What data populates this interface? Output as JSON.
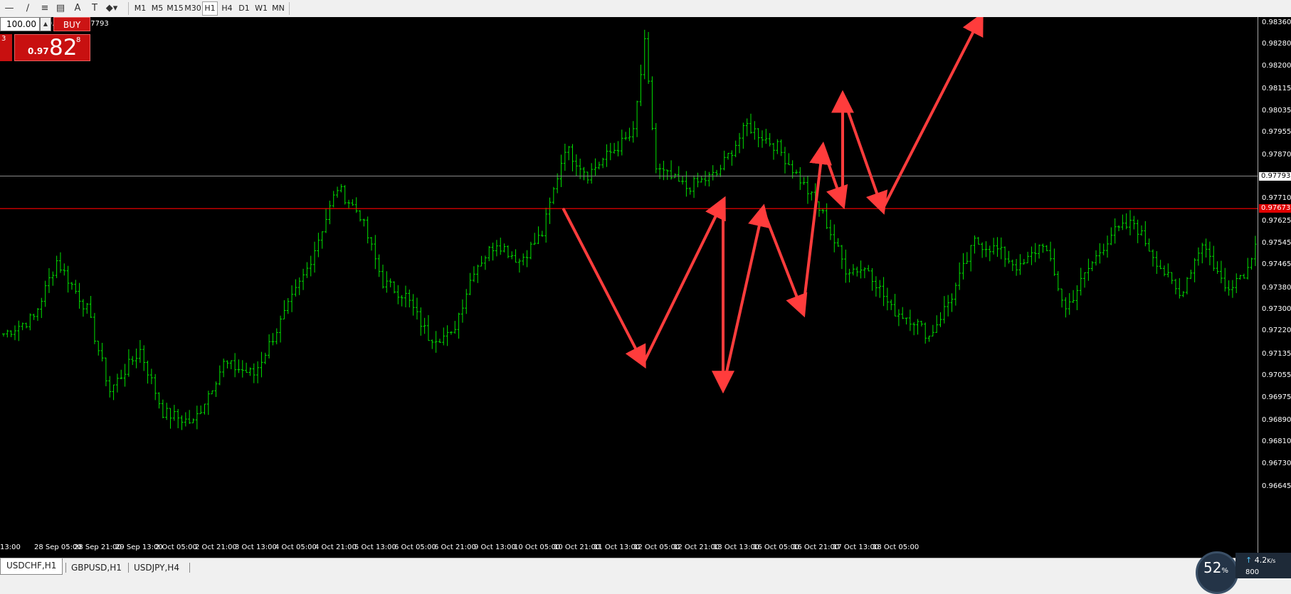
{
  "toolbar": {
    "tools": [
      "line-icon",
      "trendline-icon",
      "fibonacci-icon",
      "channel-icon",
      "text-icon",
      "text-label-icon",
      "shapes-icon"
    ],
    "timeframes": [
      "M1",
      "M5",
      "M15",
      "M30",
      "H1",
      "H4",
      "D1",
      "W1",
      "MN"
    ],
    "active_timeframe": "H1"
  },
  "ohlc_text": "774 0.97796 0.97773 0.97793",
  "trade_panel": {
    "volume": "100.00",
    "buy_label": "BUY",
    "sell_partial": "3",
    "buy_small": "0.97",
    "buy_big": "82",
    "buy_sup": "8"
  },
  "price_axis": {
    "labels": [
      "0.98360",
      "0.98280",
      "0.98200",
      "0.98115",
      "0.98035",
      "0.97955",
      "0.97870",
      "0.97710",
      "0.97625",
      "0.97545",
      "0.97465",
      "0.97380",
      "0.97300",
      "0.97220",
      "0.97135",
      "0.97055",
      "0.96975",
      "0.96890",
      "0.96810",
      "0.96730",
      "0.96645"
    ],
    "bid_label": "0.97793",
    "red_label": "0.97673"
  },
  "time_axis": [
    "13:00",
    "28 Sep 05:00",
    "28 Sep 21:00",
    "29 Sep 13:00",
    "2 Oct 05:00",
    "2 Oct 21:00",
    "3 Oct 13:00",
    "4 Oct 05:00",
    "4 Oct 21:00",
    "5 Oct 13:00",
    "6 Oct 05:00",
    "6 Oct 21:00",
    "9 Oct 13:00",
    "10 Oct 05:00",
    "10 Oct 21:00",
    "11 Oct 13:00",
    "12 Oct 05:00",
    "12 Oct 21:00",
    "13 Oct 13:00",
    "16 Oct 05:00",
    "16 Oct 21:00",
    "17 Oct 13:00",
    "18 Oct 05:00"
  ],
  "chart_data": {
    "type": "candlestick-hl",
    "symbol_timeframe": "USDCHF,H1",
    "price_min": 0.96645,
    "price_max": 0.9836,
    "bid_line": 0.97793,
    "red_level": 0.97673,
    "colors": {
      "bars": "#00e000",
      "red_level": "#ff0000",
      "bid_line": "#8a8a8a",
      "arrows": "#ff3c3c"
    },
    "anchors": [
      [
        0,
        0.9721
      ],
      [
        8,
        0.9727
      ],
      [
        14,
        0.9748
      ],
      [
        22,
        0.973
      ],
      [
        28,
        0.97
      ],
      [
        36,
        0.9715
      ],
      [
        42,
        0.9692
      ],
      [
        50,
        0.9688
      ],
      [
        58,
        0.971
      ],
      [
        66,
        0.9706
      ],
      [
        74,
        0.9728
      ],
      [
        80,
        0.9745
      ],
      [
        88,
        0.9775
      ],
      [
        94,
        0.9765
      ],
      [
        100,
        0.974
      ],
      [
        106,
        0.9735
      ],
      [
        112,
        0.972
      ],
      [
        118,
        0.972
      ],
      [
        124,
        0.9745
      ],
      [
        130,
        0.9755
      ],
      [
        136,
        0.9748
      ],
      [
        142,
        0.9758
      ],
      [
        148,
        0.979
      ],
      [
        154,
        0.978
      ],
      [
        160,
        0.9788
      ],
      [
        166,
        0.9795
      ],
      [
        169,
        0.9828
      ],
      [
        172,
        0.9782
      ],
      [
        180,
        0.9775
      ],
      [
        188,
        0.978
      ],
      [
        196,
        0.9798
      ],
      [
        204,
        0.979
      ],
      [
        210,
        0.9778
      ],
      [
        216,
        0.9765
      ],
      [
        222,
        0.9745
      ],
      [
        228,
        0.9745
      ],
      [
        234,
        0.973
      ],
      [
        240,
        0.9726
      ],
      [
        244,
        0.972
      ],
      [
        250,
        0.9735
      ],
      [
        256,
        0.9755
      ],
      [
        262,
        0.9752
      ],
      [
        268,
        0.9745
      ],
      [
        274,
        0.9755
      ],
      [
        280,
        0.973
      ],
      [
        286,
        0.9745
      ],
      [
        292,
        0.9758
      ],
      [
        298,
        0.9762
      ],
      [
        304,
        0.9748
      ],
      [
        310,
        0.9735
      ],
      [
        316,
        0.9755
      ],
      [
        322,
        0.9738
      ],
      [
        328,
        0.9745
      ],
      [
        334,
        0.9778
      ],
      [
        338,
        0.9765
      ],
      [
        342,
        0.9795
      ],
      [
        346,
        0.9785
      ],
      [
        352,
        0.9782
      ],
      [
        356,
        0.9779
      ]
    ],
    "arrows": [
      {
        "from": [
          "10 Oct 21:00",
          0.9767
        ],
        "to": [
          "12 Oct 05:00",
          0.971
        ]
      },
      {
        "from": [
          "12 Oct 05:00",
          0.971
        ],
        "to": [
          "13 Oct 13:00",
          0.977
        ]
      },
      {
        "from": [
          "13 Oct 13:00",
          0.977
        ],
        "to": [
          "13 Oct 13:00",
          0.9701
        ]
      },
      {
        "from": [
          "13 Oct 13:00",
          0.9701
        ],
        "to": [
          "16 Oct 05:00",
          0.9767
        ]
      },
      {
        "from": [
          "16 Oct 05:00",
          0.9767
        ],
        "to": [
          "16 Oct 21:00",
          0.9729
        ]
      },
      {
        "from": [
          "16 Oct 21:00",
          0.9729
        ],
        "to": [
          "17 Oct 05:00",
          0.979
        ]
      },
      {
        "from": [
          "17 Oct 05:00",
          0.979
        ],
        "to": [
          "17 Oct 13:00",
          0.9769
        ]
      },
      {
        "from": [
          "17 Oct 13:00",
          0.9769
        ],
        "to": [
          "17 Oct 13:00",
          0.9809
        ]
      },
      {
        "from": [
          "17 Oct 13:00",
          0.9809
        ],
        "to": [
          "18 Oct 05:00",
          0.9767
        ]
      },
      {
        "from": [
          "18 Oct 05:00",
          0.9767
        ],
        "to": [
          "18 Oct 21:00",
          0.9838
        ]
      }
    ]
  },
  "tabs": [
    "USDCHF,H1",
    "GBPUSD,H1",
    "USDJPY,H4"
  ],
  "active_tab": "USDCHF,H1",
  "net_widget": {
    "percent": "52",
    "percent_sym": "%",
    "upload": "4.2",
    "upload_unit": "K/s",
    "download": "800"
  }
}
